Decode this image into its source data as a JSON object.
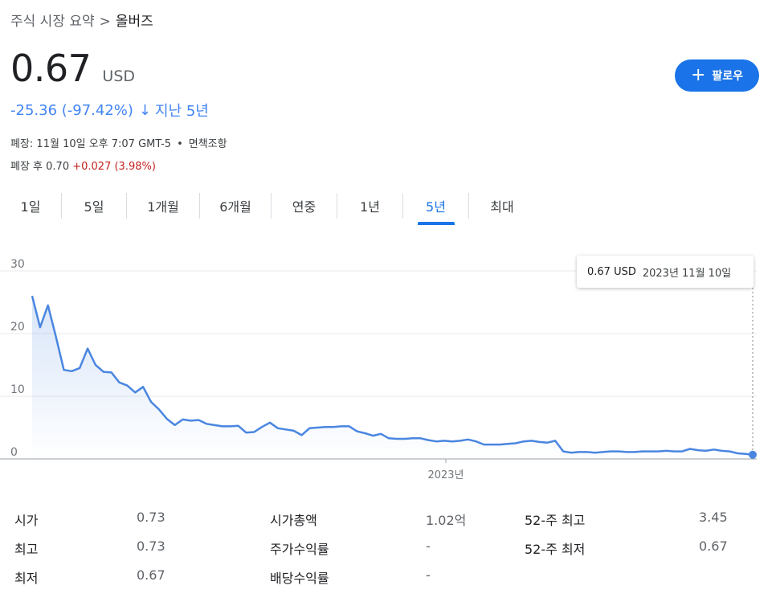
{
  "breadcrumb": {
    "parent": "주식 시장 요약",
    "separator": ">",
    "current": "올버즈"
  },
  "price": {
    "value": "0.67",
    "currency": "USD"
  },
  "follow_button": {
    "label": "팔로우"
  },
  "change": {
    "text": "-25.36 (-97.42%)",
    "arrow": "↓",
    "period": "지난 5년"
  },
  "meta": {
    "close_label": "폐장: 11월 10일 오후 7:07 GMT-5",
    "dot": "•",
    "disclaimer": "면책조항",
    "after_label": "폐장 후 0.70",
    "after_change": "+0.027 (3.98%)"
  },
  "tabs": [
    "1일",
    "5일",
    "1개월",
    "6개월",
    "연중",
    "1년",
    "5년",
    "최대"
  ],
  "active_tab": "5년",
  "colors": {
    "accent": "#1a73e8",
    "line": "#4a86e0",
    "positive": "#c5221f",
    "grid": "#e8eaed"
  },
  "tooltip": {
    "price": "0.67 USD",
    "date": "2023년 11월 10일"
  },
  "chart_data": {
    "type": "area",
    "ylim": [
      0,
      30
    ],
    "y_ticks": [
      "0",
      "10",
      "20",
      "30"
    ],
    "x_tick_labels": [
      "2023년"
    ],
    "x": [
      0,
      0.011,
      0.022,
      0.033,
      0.044,
      0.055,
      0.066,
      0.077,
      0.088,
      0.099,
      0.11,
      0.121,
      0.132,
      0.143,
      0.154,
      0.165,
      0.176,
      0.187,
      0.198,
      0.209,
      0.22,
      0.231,
      0.242,
      0.253,
      0.264,
      0.275,
      0.286,
      0.297,
      0.308,
      0.319,
      0.33,
      0.341,
      0.352,
      0.363,
      0.374,
      0.385,
      0.396,
      0.407,
      0.418,
      0.429,
      0.44,
      0.451,
      0.462,
      0.473,
      0.484,
      0.495,
      0.506,
      0.517,
      0.528,
      0.539,
      0.55,
      0.561,
      0.572,
      0.583,
      0.594,
      0.605,
      0.616,
      0.627,
      0.638,
      0.649,
      0.66,
      0.671,
      0.682,
      0.693,
      0.704,
      0.715,
      0.726,
      0.737,
      0.748,
      0.759,
      0.77,
      0.781,
      0.792,
      0.803,
      0.814,
      0.825,
      0.836,
      0.847,
      0.858,
      0.869,
      0.88,
      0.891,
      0.902,
      0.913,
      0.924,
      0.935,
      0.946,
      0.957,
      0.968,
      0.979,
      0.99,
      1.0
    ],
    "values": [
      26,
      21,
      24.5,
      19.5,
      14.2,
      14,
      14.5,
      17.6,
      15,
      13.9,
      13.8,
      12.2,
      11.7,
      10.6,
      11.5,
      9.1,
      7.9,
      6.4,
      5.4,
      6.3,
      6.1,
      6.2,
      5.6,
      5.4,
      5.2,
      5.2,
      5.3,
      4.2,
      4.3,
      5.1,
      5.8,
      4.9,
      4.7,
      4.5,
      3.8,
      4.9,
      5,
      5.1,
      5.1,
      5.2,
      5.2,
      4.4,
      4.1,
      3.7,
      4,
      3.3,
      3.2,
      3.2,
      3.3,
      3.3,
      3,
      2.8,
      2.9,
      2.8,
      2.9,
      3.1,
      2.8,
      2.3,
      2.3,
      2.3,
      2.4,
      2.5,
      2.8,
      2.9,
      2.7,
      2.6,
      2.9,
      1.2,
      1,
      1.1,
      1.1,
      1,
      1.1,
      1.2,
      1.2,
      1.1,
      1.1,
      1.2,
      1.2,
      1.2,
      1.3,
      1.2,
      1.2,
      1.6,
      1.4,
      1.3,
      1.5,
      1.3,
      1.2,
      0.9,
      0.8,
      0.67
    ],
    "last_value": 0.67
  },
  "stats": [
    {
      "label": "시가",
      "value": "0.73"
    },
    {
      "label": "최고",
      "value": "0.73"
    },
    {
      "label": "최저",
      "value": "0.67"
    },
    {
      "label": "시가총액",
      "value": "1.02억"
    },
    {
      "label": "주가수익률",
      "value": "-"
    },
    {
      "label": "배당수익률",
      "value": "-"
    },
    {
      "label": "52-주 최고",
      "value": "3.45"
    },
    {
      "label": "52-주 최저",
      "value": "0.67"
    }
  ]
}
